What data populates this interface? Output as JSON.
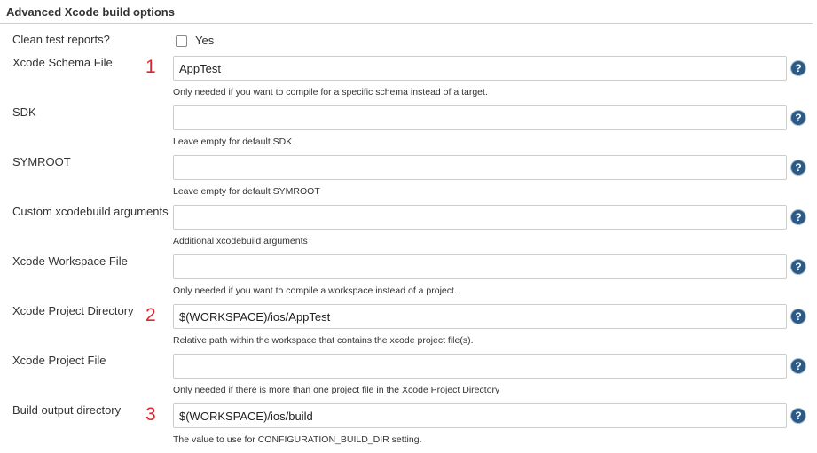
{
  "section": {
    "title": "Advanced Xcode build options"
  },
  "clean_test_reports": {
    "label": "Clean test reports?",
    "checkbox_label": "Yes",
    "checked": false
  },
  "fields": [
    {
      "label": "Xcode Schema File",
      "value": "AppTest",
      "help": "Only needed if you want to compile for a specific schema instead of a target.",
      "annotation": "1"
    },
    {
      "label": "SDK",
      "value": "",
      "help": "Leave empty for default SDK",
      "annotation": ""
    },
    {
      "label": "SYMROOT",
      "value": "",
      "help": "Leave empty for default SYMROOT",
      "annotation": ""
    },
    {
      "label": "Custom xcodebuild arguments",
      "value": "",
      "help": "Additional xcodebuild arguments",
      "annotation": ""
    },
    {
      "label": "Xcode Workspace File",
      "value": "",
      "help": "Only needed if you want to compile a workspace instead of a project.",
      "annotation": ""
    },
    {
      "label": "Xcode Project Directory",
      "value": "$(WORKSPACE)/ios/AppTest",
      "help": "Relative path within the workspace that contains the xcode project file(s).",
      "annotation": "2"
    },
    {
      "label": "Xcode Project File",
      "value": "",
      "help": "Only needed if there is more than one project file in the Xcode Project Directory",
      "annotation": ""
    },
    {
      "label": "Build output directory",
      "value": "$(WORKSPACE)/ios/build",
      "help": "The value to use for CONFIGURATION_BUILD_DIR setting.",
      "annotation": "3"
    }
  ],
  "help_icon": {
    "name": "help-icon",
    "glyph": "?",
    "color": "#2b5a87"
  },
  "annotation_color": "#e0242e"
}
